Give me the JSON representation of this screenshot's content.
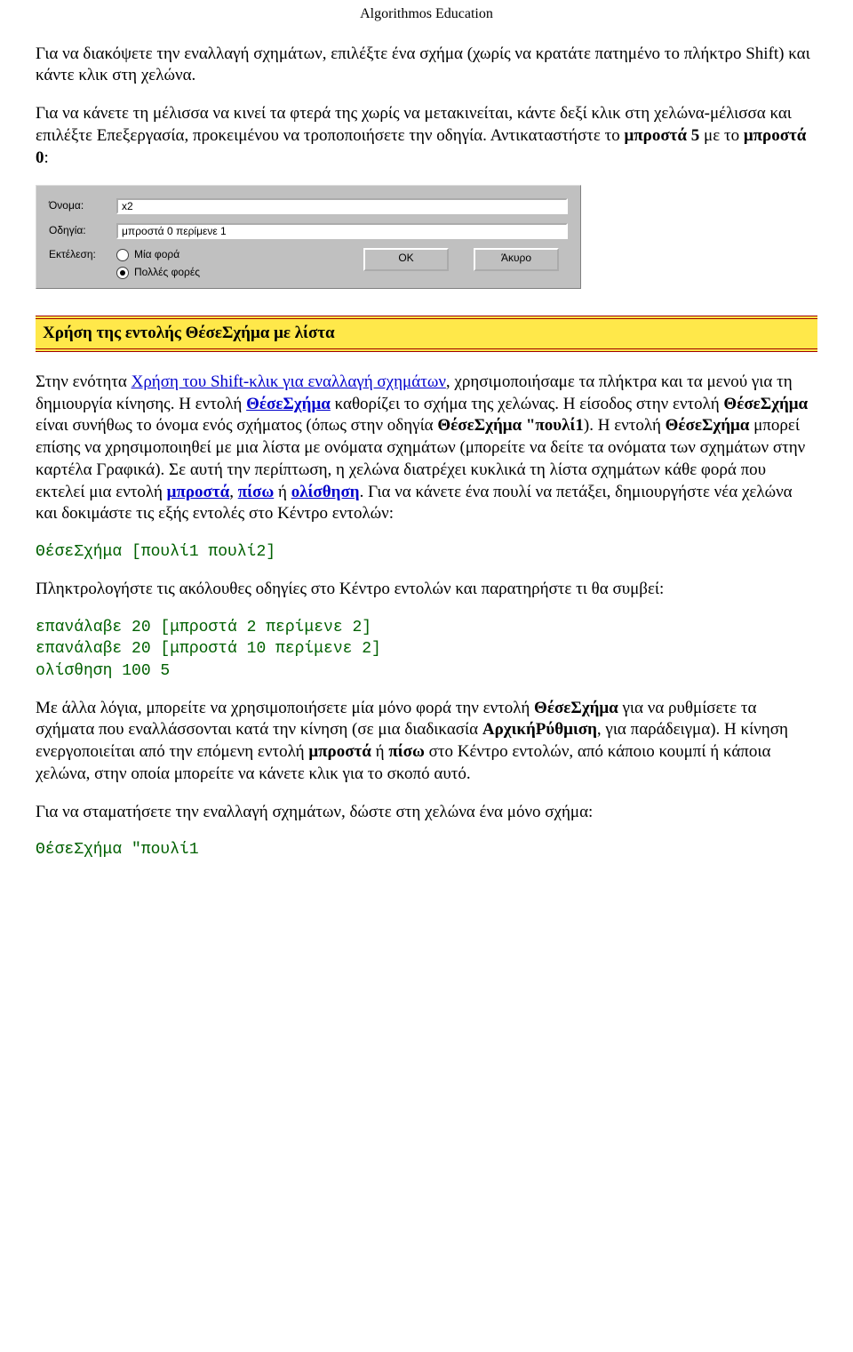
{
  "header": "Algorithmos Education",
  "para1": "Για να διακόψετε την εναλλαγή σχημάτων, επιλέξτε ένα σχήμα (χωρίς να κρατάτε πατημένο το πλήκτρο Shift) και κάντε κλικ στη χελώνα.",
  "para2_a": "Για να κάνετε τη μέλισσα να κινεί τα φτερά της χωρίς να μετακινείται, κάντε δεξί κλικ στη χελώνα-μέλισσα και επιλέξτε Επεξεργασία, προκειμένου να τροποποιήσετε την οδηγία. Αντικαταστήστε το ",
  "para2_b": "μπροστά 5",
  "para2_c": " με το ",
  "para2_d": "μπροστά 0",
  "para2_e": ":",
  "dialog": {
    "name_label": "Όνομα:",
    "name_value": "x2",
    "instr_label": "Οδηγία:",
    "instr_value": "μπροστά 0 περίμενε 1",
    "exec_label": "Εκτέλεση:",
    "radio_once": "Μία φορά",
    "radio_many": "Πολλές φορές",
    "ok": "OK",
    "cancel": "Άκυρο"
  },
  "section_title": "Χρήση της εντολής ΘέσεΣχήμα με λίστα",
  "body": {
    "p3_a": "Στην ενότητα ",
    "p3_link1": "Χρήση του Shift-κλικ για εναλλαγή σχημάτων",
    "p3_b": ", χρησιμοποιήσαμε τα πλήκτρα και τα μενού για τη δημιουργία κίνησης. Η εντολή ",
    "p3_link2": "ΘέσεΣχήμα",
    "p3_c": " καθορίζει το σχήμα της χελώνας. Η είσοδος στην εντολή ",
    "p3_bold1": "ΘέσεΣχήμα",
    "p3_d": " είναι συνήθως το όνομα ενός σχήματος (όπως στην οδηγία ",
    "p3_bold2": "ΘέσεΣχήμα \"πουλί1",
    "p3_e": "). Η εντολή ",
    "p3_bold3": "ΘέσεΣχήμα",
    "p3_f": " μπορεί επίσης να χρησιμοποιηθεί με μια λίστα με ονόματα σχημάτων (μπορείτε να δείτε τα ονόματα των σχημάτων στην καρτέλα Γραφικά). Σε αυτή την περίπτωση, η χελώνα διατρέχει κυκλικά τη λίστα σχημάτων κάθε φορά που εκτελεί μια εντολή ",
    "p3_link3": "μπροστά",
    "p3_g": ", ",
    "p3_link4": "πίσω",
    "p3_h": " ή ",
    "p3_link5": "ολίσθηση",
    "p3_i": ". Για να κάνετε ένα πουλί να πετάξει, δημιουργήστε νέα χελώνα και δοκιμάστε τις εξής εντολές στο Κέντρο εντολών:"
  },
  "code1": "ΘέσεΣχήμα [πουλί1 πουλί2]",
  "para4": "Πληκτρολογήστε τις ακόλουθες οδηγίες στο Κέντρο εντολών και παρατηρήστε τι θα συμβεί:",
  "code2": "επανάλαβε 20 [μπροστά 2 περίμενε 2]\nεπανάλαβε 20 [μπροστά 10 περίμενε 2]\nολίσθηση 100 5",
  "p5_a": "Με άλλα λόγια, μπορείτε να χρησιμοποιήσετε μία μόνο φορά την εντολή ",
  "p5_b1": "ΘέσεΣχήμα",
  "p5_b": " για να ρυθμίσετε τα σχήματα που εναλλάσσονται κατά την κίνηση (σε μια διαδικασία ",
  "p5_b2": "ΑρχικήΡύθμιση",
  "p5_c": ", για παράδειγμα). Η κίνηση ενεργοποιείται από την επόμενη εντολή ",
  "p5_b3": "μπροστά",
  "p5_d": " ή ",
  "p5_b4": "πίσω",
  "p5_e": " στο Κέντρο εντολών, από κάποιο κουμπί ή κάποια χελώνα, στην οποία μπορείτε να κάνετε κλικ για το σκοπό αυτό.",
  "para6": "Για να σταματήσετε την εναλλαγή σχημάτων, δώστε στη χελώνα ένα μόνο σχήμα:",
  "code3": "ΘέσεΣχήμα \"πουλί1"
}
